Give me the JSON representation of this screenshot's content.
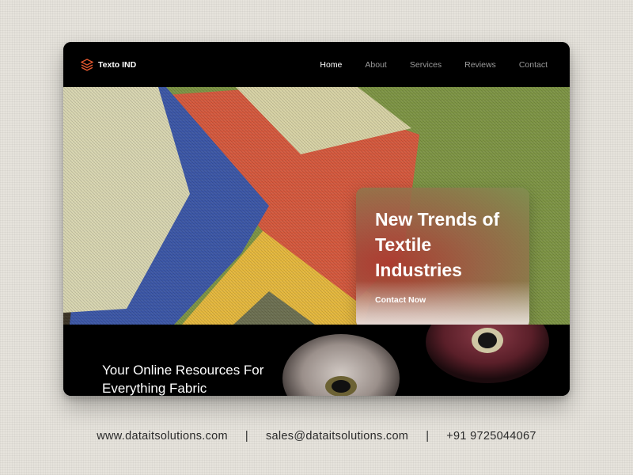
{
  "brand": {
    "name": "Texto IND",
    "logo_icon": "layers-icon",
    "accent_color": "#e2572f"
  },
  "nav": {
    "items": [
      {
        "label": "Home",
        "active": true
      },
      {
        "label": "About",
        "active": false
      },
      {
        "label": "Services",
        "active": false
      },
      {
        "label": "Reviews",
        "active": false
      },
      {
        "label": "Contact",
        "active": false
      }
    ]
  },
  "hero": {
    "title": "New Trends of Textile Industries",
    "cta_label": "Contact Now",
    "swatch_colors": [
      "#d9d6b2",
      "#3d58a8",
      "#d65a3f",
      "#d8d3a6",
      "#7f9646",
      "#e6b93f",
      "#6e7152"
    ]
  },
  "section": {
    "tagline": "Your Online Resources For Everything Fabric"
  },
  "footer": {
    "website": "www.dataitsolutions.com",
    "email": "sales@dataitsolutions.com",
    "phone": "+91 9725044067",
    "separator": "|"
  }
}
